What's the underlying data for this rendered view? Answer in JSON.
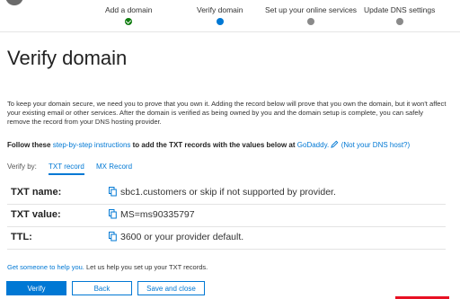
{
  "wizard": {
    "steps": [
      {
        "label": "Add a domain",
        "state": "done"
      },
      {
        "label": "Verify domain",
        "state": "active"
      },
      {
        "label": "Set up your online services",
        "state": "todo"
      },
      {
        "label": "Update DNS settings",
        "state": "todo"
      }
    ]
  },
  "page_title": "Verify domain",
  "description": "To keep your domain secure, we need you to prove that you own it. Adding the record below will prove that you own the domain, but it won't affect your existing email or other services. After the domain is verified as being owned by you and the domain setup is complete, you can safely remove the record from your DNS hosting provider.",
  "follow": {
    "prefix": "Follow these",
    "link": "step-by-step instructions",
    "middle": "to add the TXT records with the values below at",
    "provider": "GoDaddy.",
    "not_host": "(Not your DNS host?)"
  },
  "verify_by": {
    "label": "Verify by:",
    "tabs": [
      "TXT record",
      "MX Record"
    ],
    "selected": "TXT record"
  },
  "records": [
    {
      "label": "TXT name:",
      "value": "sbc1.customers or skip if not supported by provider."
    },
    {
      "label": "TXT value:",
      "value": "MS=ms90335797"
    },
    {
      "label": "TTL:",
      "value": "3600 or your provider default."
    }
  ],
  "help": {
    "link": "Get someone to help you.",
    "text": "Let us help you set up your TXT records."
  },
  "buttons": {
    "verify": "Verify",
    "back": "Back",
    "save_close": "Save and close"
  },
  "colors": {
    "accent": "#0078d4",
    "done": "#107c10",
    "todo": "#8a8a8a"
  }
}
